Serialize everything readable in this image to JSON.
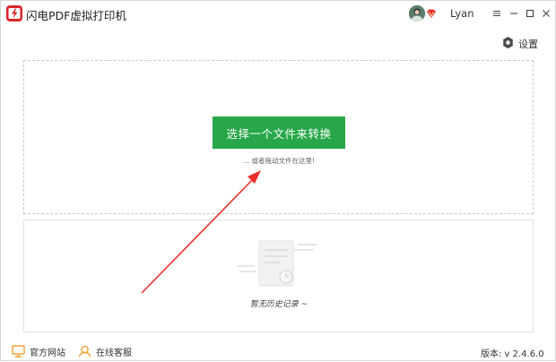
{
  "app": {
    "title": "闪电PDF虚拟打印机"
  },
  "user": {
    "name": "Lyan"
  },
  "settings": {
    "label": "设置"
  },
  "dropzone": {
    "button_label": "选择一个文件来转换",
    "hint": "... 或者拖动文件在这里!"
  },
  "history": {
    "empty_text": "暂无历史记录 ~"
  },
  "footer": {
    "website": "官方网站",
    "support": "在线客服",
    "version": "版本: v 2.4.6.0"
  },
  "colors": {
    "accent_green": "#27a749",
    "brand_red": "#d9262b",
    "arrow_red": "#e8302a",
    "icon_orange": "#f0a032"
  },
  "icons": {
    "app": "lightning-logo-icon",
    "vip": "vip-badge-icon",
    "settings": "gear-icon",
    "website": "monitor-icon",
    "support": "headset-icon",
    "empty": "empty-document-icon"
  }
}
